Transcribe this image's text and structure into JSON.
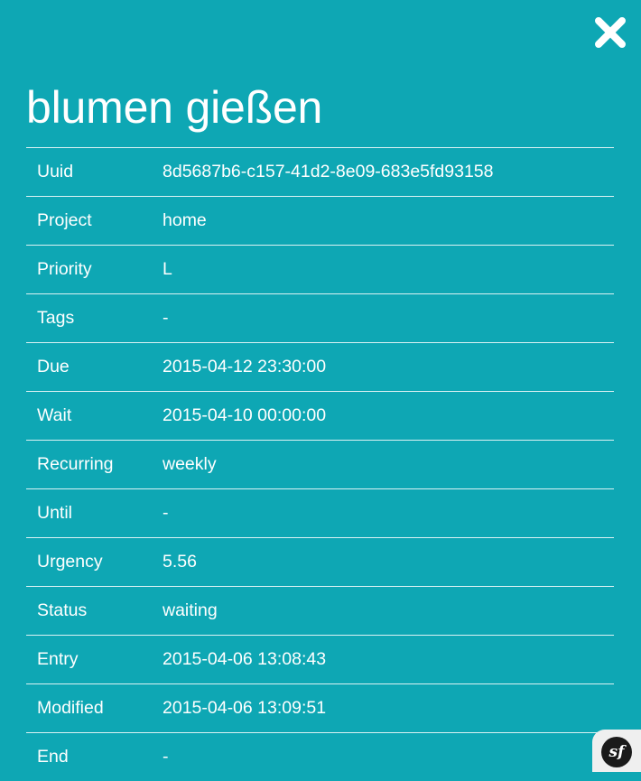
{
  "task": {
    "title": "blumen gießen",
    "close_icon": "close-icon",
    "fields": [
      {
        "label": "Uuid",
        "value": "8d5687b6-c157-41d2-8e09-683e5fd93158"
      },
      {
        "label": "Project",
        "value": "home"
      },
      {
        "label": "Priority",
        "value": "L"
      },
      {
        "label": "Tags",
        "value": "-"
      },
      {
        "label": "Due",
        "value": "2015-04-12 23:30:00"
      },
      {
        "label": "Wait",
        "value": "2015-04-10 00:00:00"
      },
      {
        "label": "Recurring",
        "value": "weekly"
      },
      {
        "label": "Until",
        "value": "-"
      },
      {
        "label": "Urgency",
        "value": "5.56"
      },
      {
        "label": "Status",
        "value": "waiting"
      },
      {
        "label": "Entry",
        "value": "2015-04-06 13:08:43"
      },
      {
        "label": "Modified",
        "value": "2015-04-06 13:09:51"
      },
      {
        "label": "End",
        "value": "-"
      }
    ]
  },
  "toolbar": {
    "logo_text": "sf",
    "logo_icon": "symfony-logo-icon"
  },
  "colors": {
    "background": "#0ea7b4",
    "text": "#ffffff",
    "badge_background": "#efefef",
    "logo_background": "#1a1a1a"
  }
}
